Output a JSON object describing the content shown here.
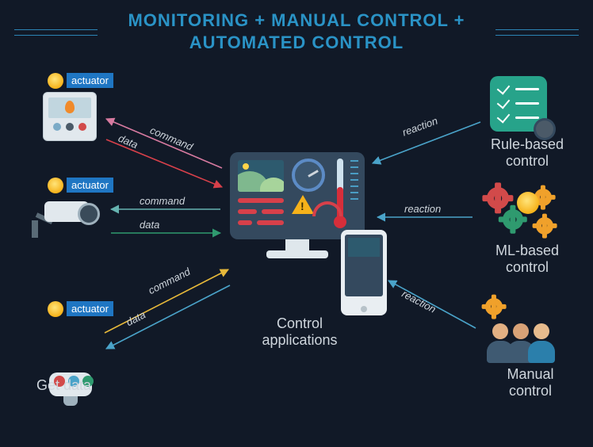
{
  "title_line1": "MONITORING + MANUAL CONTROL +",
  "title_line2": "AUTOMATED CONTROL",
  "center_caption": "Control\napplications",
  "left_caption": "Get data",
  "right": {
    "rule": "Rule-based\ncontrol",
    "ml": "ML-based\ncontrol",
    "manual": "Manual\ncontrol"
  },
  "actuator_tag": "actuator",
  "arrow_labels": {
    "data": "data",
    "command": "command",
    "reaction": "reaction"
  },
  "colors": {
    "a1_data": "#d7404a",
    "a1_cmd": "#d77aa0",
    "a2_data": "#2f9a6f",
    "a2_cmd": "#66b3b0",
    "a3_data": "#e6b83a",
    "a3_cmd": "#4aa3c9",
    "reaction": "#4aa3c9"
  }
}
